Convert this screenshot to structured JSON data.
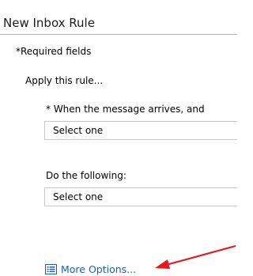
{
  "window": {
    "title": "New Inbox Rule"
  },
  "form": {
    "required_note": "*Required fields",
    "apply_heading": "Apply this rule...",
    "condition": {
      "label": "* When the message arrives, and",
      "selected": "Select one"
    },
    "action": {
      "label": "Do the following:",
      "selected": "Select one"
    },
    "more_options": {
      "label": "More Options...",
      "icon": "list-options-icon",
      "color": "#1b5fb5"
    }
  },
  "annotation": {
    "icon": "arrow-pointer",
    "color": "#e8171c"
  }
}
